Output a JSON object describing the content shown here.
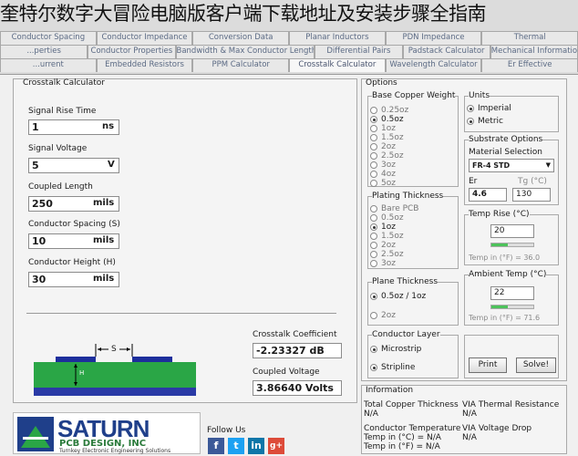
{
  "overlay_title": "奎特尔数字大冒险电脑版客户端下载地址及安装步骤全指南",
  "tabs_row1": [
    "Conductor Spacing",
    "Conductor Impedance",
    "Conversion Data",
    "Planar Inductors",
    "PDN Impedance",
    "Thermal"
  ],
  "tabs_row2": [
    "...perties",
    "Conductor Properties",
    "Bandwidth & Max Conductor Length",
    "Differential Pairs",
    "Padstack Calculator",
    "Mechanical Information"
  ],
  "tabs_row3": [
    "...urrent",
    "Embedded Resistors",
    "PPM Calculator",
    "Crosstalk Calculator",
    "Wavelength Calculator",
    "Er Effective"
  ],
  "calc": {
    "title": "Crosstalk Calculator",
    "rise_label": "Signal Rise Time",
    "rise_value": "1",
    "rise_unit": "ns",
    "voltage_label": "Signal Voltage",
    "voltage_value": "5",
    "voltage_unit": "V",
    "length_label": "Coupled Length",
    "length_value": "250",
    "length_unit": "mils",
    "spacing_label": "Conductor Spacing (S)",
    "spacing_value": "10",
    "spacing_unit": "mils",
    "height_label": "Conductor Height (H)",
    "height_value": "30",
    "height_unit": "mils",
    "diagram_s": "S",
    "diagram_h": "H",
    "coeff_label": "Crosstalk Coefficient",
    "coeff_value": "-2.23327 dB",
    "coupled_label": "Coupled Voltage",
    "coupled_value": "3.86640 Volts"
  },
  "logo": {
    "main": "SATURN",
    "sub": "PCB DESIGN, INC",
    "tagline": "Turnkey Electronic Engineering Solutions"
  },
  "follow": {
    "label": "Follow Us",
    "icons": [
      "f",
      "t",
      "in",
      "g+"
    ]
  },
  "options": {
    "title": "Options",
    "base_copper_title": "Base Copper Weight",
    "base_copper": [
      "0.25oz",
      "0.5oz",
      "1oz",
      "1.5oz",
      "2oz",
      "2.5oz",
      "3oz",
      "4oz",
      "5oz"
    ],
    "plating_title": "Plating Thickness",
    "plating": [
      "Bare PCB",
      "0.5oz",
      "1oz",
      "1.5oz",
      "2oz",
      "2.5oz",
      "3oz"
    ],
    "plane_title": "Plane Thickness",
    "plane": [
      "0.5oz / 1oz",
      "2oz"
    ],
    "layer_title": "Conductor Layer",
    "layer": [
      "Microstrip",
      "Stripline"
    ],
    "units_title": "Units",
    "units": [
      "Imperial",
      "Metric"
    ],
    "substrate_title": "Substrate Options",
    "material_label": "Material Selection",
    "material_value": "FR-4 STD",
    "er_label": "Er",
    "er_value": "4.6",
    "tg_label": "Tg (°C)",
    "tg_value": "130",
    "temp_rise_title": "Temp Rise (°C)",
    "temp_rise_value": "20",
    "temp_rise_f": "Temp in (°F) = 36.0",
    "ambient_title": "Ambient Temp (°C)",
    "ambient_value": "22",
    "ambient_f": "Temp in (°F) = 71.6",
    "print_label": "Print",
    "solve_label": "Solve!"
  },
  "info": {
    "title": "Information",
    "tct_label": "Total Copper Thickness",
    "tct_value": "N/A",
    "via_res_label": "VIA Thermal Resistance",
    "via_res_value": "N/A",
    "cond_temp_label": "Conductor Temperature",
    "cond_temp_c": "Temp in (°C) = N/A",
    "cond_temp_f": "Temp in (°F) = N/A",
    "via_drop_label": "VIA Voltage Drop",
    "via_drop_value": "N/A"
  }
}
